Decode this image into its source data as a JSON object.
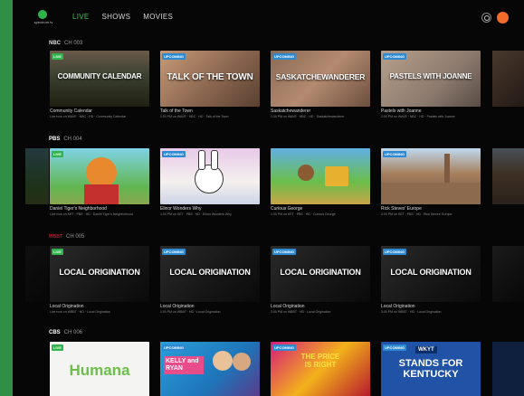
{
  "app": {
    "logo_text": "spectrum tv",
    "nav": [
      {
        "label": "LIVE",
        "active": true
      },
      {
        "label": "SHOWS",
        "active": false
      },
      {
        "label": "MOVIES",
        "active": false
      }
    ],
    "colors": {
      "accent": "#38c657",
      "live": "#2fb34a",
      "upcoming": "#2d8ad1",
      "avatar": "#f26b2a"
    }
  },
  "rows": [
    {
      "network": "NBC",
      "channel": "CH 003",
      "tiles": [
        {
          "badge": "LIVE",
          "overlay": "COMMUNITY CALENDAR",
          "title": "Community Calendar",
          "meta": "Live now on WAVE · NBC · HD · Community Calendar"
        },
        {
          "badge": "UPCOMING",
          "overlay": "TALK OF THE TOWN",
          "title": "Talk of the Town",
          "meta": "1:00 PM on WAVE · NBC · HD · Talk of the Town"
        },
        {
          "badge": "UPCOMING",
          "overlay": "SASKATCHEWANDERER",
          "title": "Saskatchewanderer",
          "meta": "1:30 PM on WAVE · NBC · HD · Saskatchewanderer"
        },
        {
          "badge": "UPCOMING",
          "overlay": "PASTELS WITH JOANNE",
          "title": "Pastels with Joanne",
          "meta": "2:00 PM on WAVE · NBC · HD · Pastels with Joanne"
        }
      ]
    },
    {
      "network": "PBS",
      "channel": "CH 004",
      "tiles": [
        {
          "badge": "LIVE",
          "overlay": "",
          "title": "Daniel Tiger's Neighborhood",
          "meta": "Live now on KET · PBS · HD · Daniel Tiger's Neighborhood"
        },
        {
          "badge": "UPCOMING",
          "overlay": "",
          "title": "Elinor Wonders Why",
          "meta": "1:00 PM on KET · PBS · HD · Elinor Wonders Why"
        },
        {
          "badge": "",
          "overlay": "",
          "title": "Curious George",
          "meta": "1:30 PM on KET · PBS · HD · Curious George"
        },
        {
          "badge": "UPCOMING",
          "overlay": "",
          "title": "Rick Steves' Europe",
          "meta": "2:00 PM on KET · PBS · HD · Rick Steves' Europe"
        }
      ]
    },
    {
      "network": "WBBT",
      "channel": "CH 005",
      "tiles": [
        {
          "badge": "LIVE",
          "overlay": "LOCAL ORIGINATION",
          "title": "Local Origination",
          "meta": "Live now on WBBT · HD · Local Origination"
        },
        {
          "badge": "UPCOMING",
          "overlay": "LOCAL ORIGINATION",
          "title": "Local Origination",
          "meta": "1:00 PM on WBBT · HD · Local Origination"
        },
        {
          "badge": "UPCOMING",
          "overlay": "LOCAL ORIGINATION",
          "title": "Local Origination",
          "meta": "2:00 PM on WBBT · HD · Local Origination"
        },
        {
          "badge": "UPCOMING",
          "overlay": "LOCAL ORIGINATION",
          "title": "Local Origination",
          "meta": "3:00 PM on WBBT · HD · Local Origination"
        }
      ]
    },
    {
      "network": "CBS",
      "channel": "CH 006",
      "tiles": [
        {
          "badge": "LIVE",
          "overlay": "Humana",
          "title": "",
          "meta": ""
        },
        {
          "badge": "UPCOMING",
          "overlay": "KELLY and RYAN",
          "title": "",
          "meta": ""
        },
        {
          "badge": "UPCOMING",
          "overlay": "THE PRICE IS RIGHT",
          "title": "",
          "meta": ""
        },
        {
          "badge": "UPCOMING",
          "overlay": "STANDS FOR KENTUCKY",
          "title": "",
          "meta": "",
          "logo": "WKYT"
        }
      ]
    }
  ]
}
